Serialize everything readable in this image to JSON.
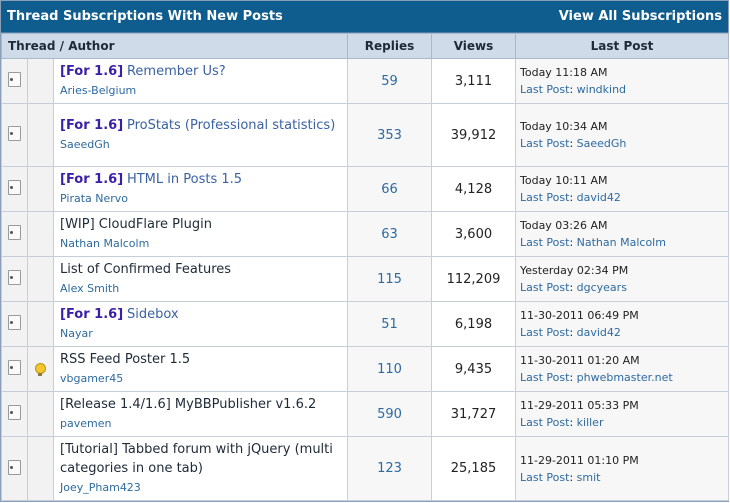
{
  "header": {
    "title": "Thread Subscriptions With New Posts",
    "view_all": "View All Subscriptions"
  },
  "columns": {
    "thread_author": "Thread / Author",
    "replies": "Replies",
    "views": "Views",
    "last_post": "Last Post"
  },
  "last_post_prefix": "Last Post",
  "threads": [
    {
      "prefix": "[For 1.6]",
      "title": "Remember Us?",
      "author": "Aries-Belgium",
      "replies": "59",
      "views": "3,111",
      "time": "Today 11:18 AM",
      "last_user": "windkind",
      "bulb": false
    },
    {
      "prefix": "[For 1.6]",
      "title": "ProStats (Professional statistics)",
      "author": "SaeedGh",
      "replies": "353",
      "views": "39,912",
      "time": "Today 10:34 AM",
      "last_user": "SaeedGh",
      "bulb": false
    },
    {
      "prefix": "[For 1.6]",
      "title": "HTML in Posts 1.5",
      "author": "Pirata Nervo",
      "replies": "66",
      "views": "4,128",
      "time": "Today 10:11 AM",
      "last_user": "david42",
      "bulb": false
    },
    {
      "prefix": "",
      "title": "[WIP] CloudFlare Plugin",
      "author": "Nathan Malcolm",
      "replies": "63",
      "views": "3,600",
      "time": "Today 03:26 AM",
      "last_user": "Nathan Malcolm",
      "bulb": false
    },
    {
      "prefix": "",
      "title": "List of Confirmed Features",
      "author": "Alex Smith",
      "replies": "115",
      "views": "112,209",
      "time": "Yesterday 02:34 PM",
      "last_user": "dgcyears",
      "bulb": false
    },
    {
      "prefix": "[For 1.6]",
      "title": "Sidebox",
      "author": "Nayar",
      "replies": "51",
      "views": "6,198",
      "time": "11-30-2011 06:49 PM",
      "last_user": "david42",
      "bulb": false
    },
    {
      "prefix": "",
      "title": "RSS Feed Poster 1.5",
      "author": "vbgamer45",
      "replies": "110",
      "views": "9,435",
      "time": "11-30-2011 01:20 AM",
      "last_user": "phwebmaster.net",
      "bulb": true
    },
    {
      "prefix": "",
      "title": "[Release 1.4/1.6] MyBBPublisher v1.6.2",
      "author": "pavemen",
      "replies": "590",
      "views": "31,727",
      "time": "11-29-2011 05:33 PM",
      "last_user": "killer",
      "bulb": false
    },
    {
      "prefix": "",
      "title": "[Tutorial] Tabbed forum with jQuery (multi categories in one tab)",
      "author": "Joey_Pham423",
      "replies": "123",
      "views": "25,185",
      "time": "11-29-2011 01:10 PM",
      "last_user": "smit",
      "bulb": false
    }
  ]
}
